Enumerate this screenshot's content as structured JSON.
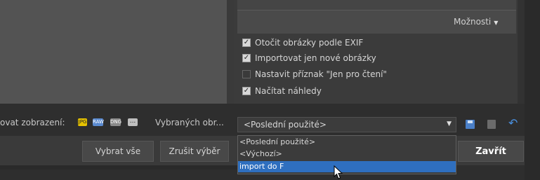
{
  "options": {
    "dropdown_label": "Možnosti",
    "items": [
      {
        "label": "Otočit obrázky podle EXIF",
        "checked": true
      },
      {
        "label": "Importovat jen nové obrázky",
        "checked": true
      },
      {
        "label": "Nastavit příznak \"Jen pro čtení\"",
        "checked": false
      },
      {
        "label": "Načítat náhledy",
        "checked": true
      }
    ]
  },
  "view": {
    "label": "ovat zobrazení:",
    "formats": [
      "JPG",
      "RAW",
      "DNG",
      "..."
    ],
    "selected_label": "Vybraných obr..."
  },
  "preset": {
    "value": "<Poslední použité>",
    "options": [
      "<Poslední použité>",
      "<Výchozí>",
      "import do F"
    ],
    "highlighted_index": 2
  },
  "buttons": {
    "select_all": "Vybrat vše",
    "deselect": "Zrušit výběr",
    "close": "Zavřít"
  },
  "colors": {
    "accent": "#2f6fbf",
    "panel": "#3b3b3b",
    "background": "#2e2e2e"
  }
}
